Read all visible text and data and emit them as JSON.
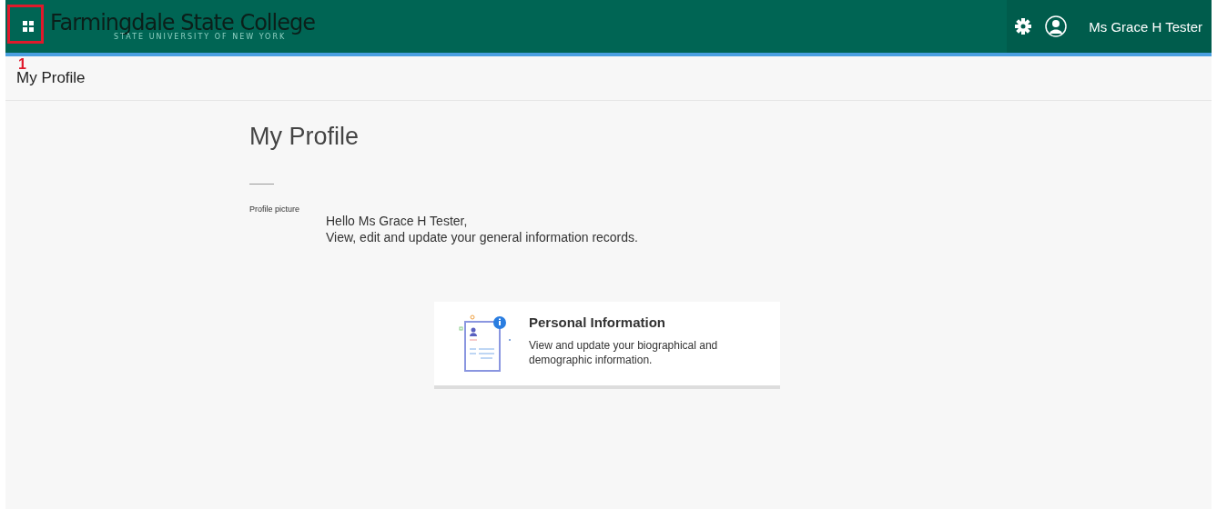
{
  "header": {
    "title": "Farmingdale State College",
    "subtitle": "STATE UNIVERSITY OF NEW YORK",
    "user_name": "Ms Grace H Tester"
  },
  "annotation": {
    "label": "1"
  },
  "breadcrumb": "My Profile",
  "page": {
    "title": "My Profile",
    "profile_picture_label": "Profile picture",
    "greeting": "Hello Ms Grace H Tester,",
    "intro": "View, edit and update your general information records."
  },
  "cards": [
    {
      "title": "Personal Information",
      "description": "View and update your biographical and demographic information."
    }
  ]
}
